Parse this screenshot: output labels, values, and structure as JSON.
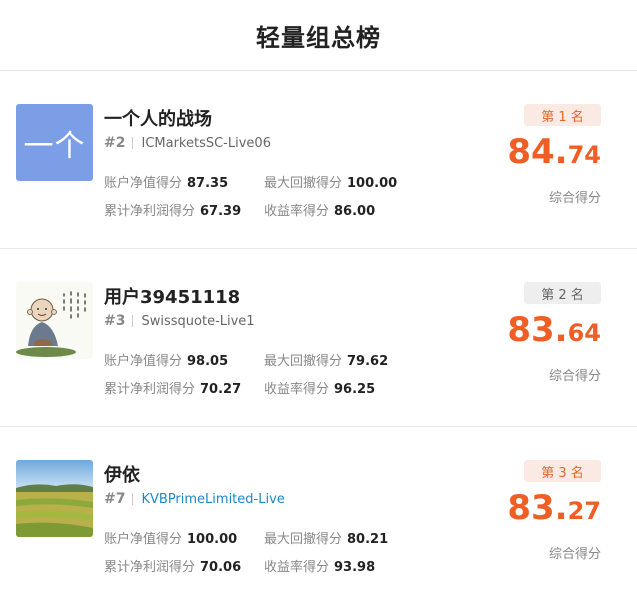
{
  "page": {
    "title": "轻量组总榜"
  },
  "entries": [
    {
      "name": "一个人的战场",
      "avatar_text": "一个",
      "rank_no": "#2",
      "account": "ICMarketsSC-Live06",
      "badge": "第 1 名",
      "score_int": "84",
      "score_dot": ".",
      "score_dec": "74",
      "score_label": "综合得分",
      "stats": [
        {
          "label": "账户净值得分",
          "value": "87.35"
        },
        {
          "label": "最大回撤得分",
          "value": "100.00"
        },
        {
          "label": "累计净利润得分",
          "value": "67.39"
        },
        {
          "label": "收益率得分",
          "value": "86.00"
        }
      ]
    },
    {
      "name": "用户39451118",
      "rank_no": "#3",
      "account": "Swissquote-Live1",
      "badge": "第 2 名",
      "score_int": "83",
      "score_dot": ".",
      "score_dec": "64",
      "score_label": "综合得分",
      "stats": [
        {
          "label": "账户净值得分",
          "value": "98.05"
        },
        {
          "label": "最大回撤得分",
          "value": "79.62"
        },
        {
          "label": "累计净利润得分",
          "value": "70.27"
        },
        {
          "label": "收益率得分",
          "value": "96.25"
        }
      ]
    },
    {
      "name": "伊依",
      "rank_no": "#7",
      "account": "KVBPrimeLimited-Live",
      "badge": "第 3 名",
      "score_int": "83",
      "score_dot": ".",
      "score_dec": "27",
      "score_label": "综合得分",
      "stats": [
        {
          "label": "账户净值得分",
          "value": "100.00"
        },
        {
          "label": "最大回撤得分",
          "value": "80.21"
        },
        {
          "label": "累计净利润得分",
          "value": "70.06"
        },
        {
          "label": "收益率得分",
          "value": "93.98"
        }
      ]
    }
  ],
  "colors": {
    "accent": "#ef5f25",
    "badge_bg_top": "#fbeae4",
    "badge_bg_gray": "#eeeeee",
    "link": "#1e88c7",
    "avatar_blue": "#7b9ee6"
  }
}
